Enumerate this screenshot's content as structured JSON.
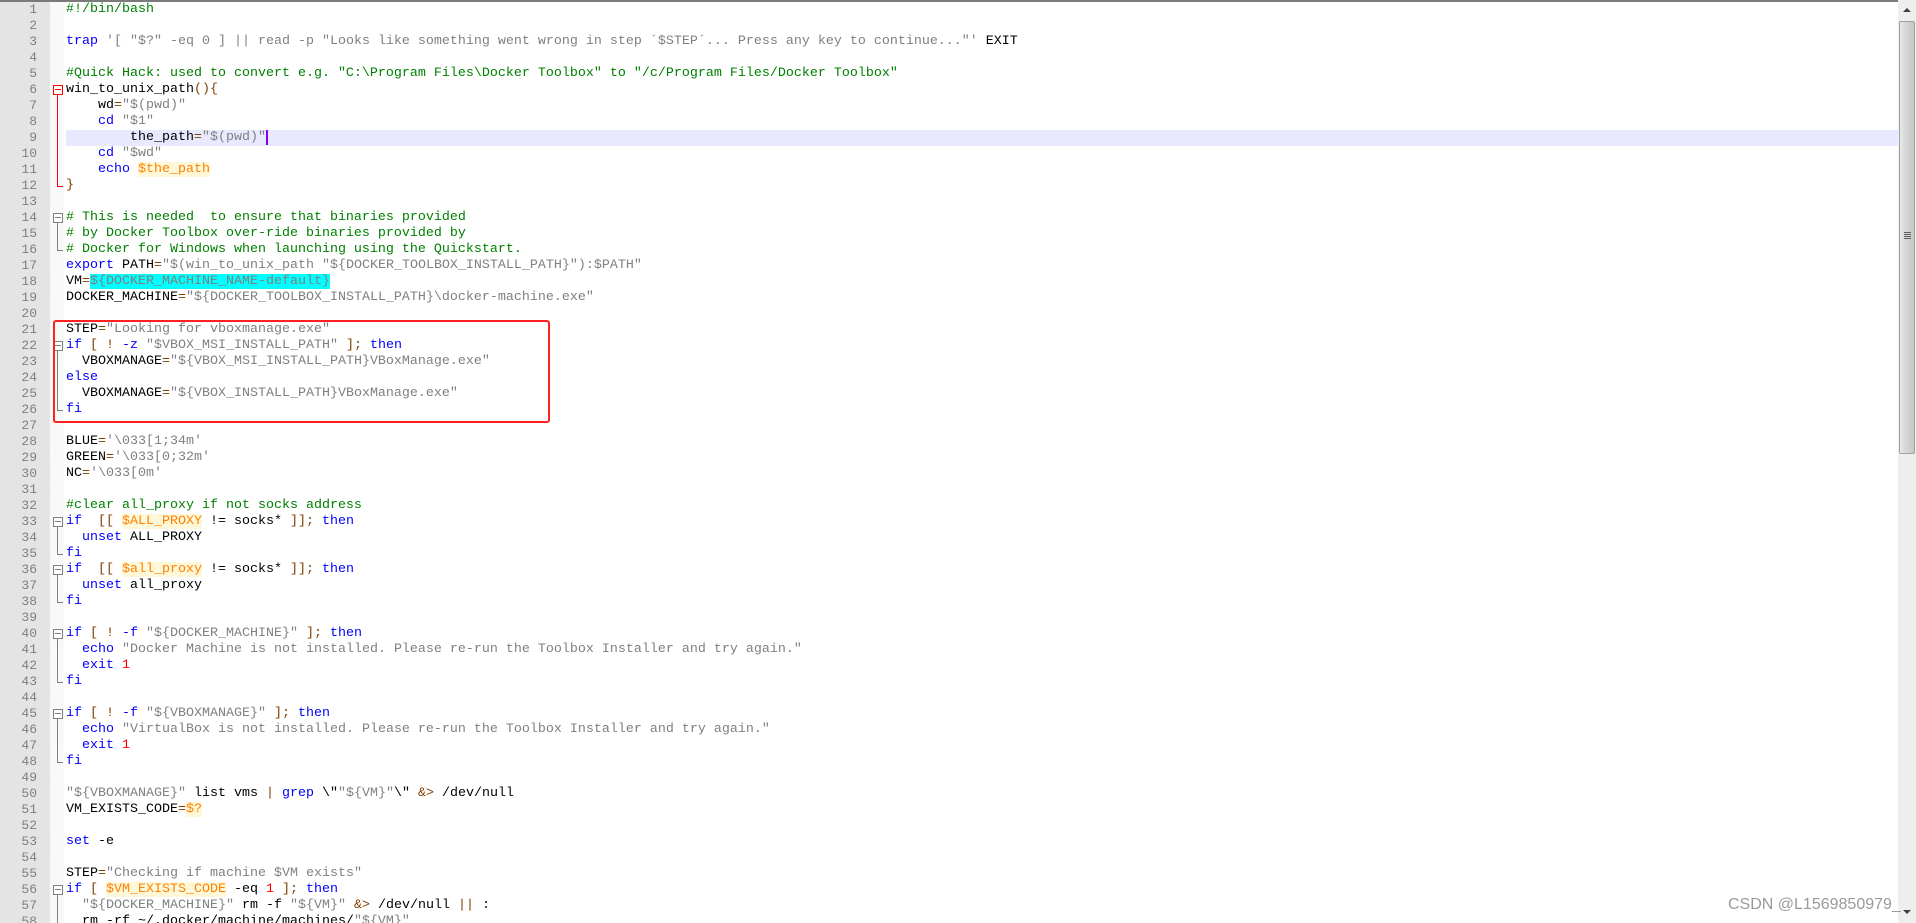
{
  "editor": {
    "current_line": 9,
    "highlighted_block": {
      "from_line": 21,
      "to_line": 26,
      "color": "#ff2020"
    },
    "lines": [
      {
        "n": "1",
        "tokens": [
          {
            "t": "#!/bin/bash",
            "c": "c"
          }
        ]
      },
      {
        "n": "2",
        "tokens": []
      },
      {
        "n": "3",
        "tokens": [
          {
            "t": "trap",
            "c": "k"
          },
          {
            "t": " ",
            "c": "d"
          },
          {
            "t": "'[ \"$?\" -eq 0 ] || read -p \"Looks like something went wrong in step ´$STEP´... Press any key to continue...\"'",
            "c": "s"
          },
          {
            "t": " EXIT",
            "c": "d"
          }
        ]
      },
      {
        "n": "4",
        "tokens": []
      },
      {
        "n": "5",
        "tokens": [
          {
            "t": "#Quick Hack: used to convert e.g. \"C:\\Program Files\\Docker Toolbox\" to \"/c/Program Files/Docker Toolbox\"",
            "c": "c"
          }
        ]
      },
      {
        "n": "6",
        "fold": "open",
        "active": true,
        "tokens": [
          {
            "t": "win_to_unix_path",
            "c": "d"
          },
          {
            "t": "(){",
            "c": "o"
          }
        ]
      },
      {
        "n": "7",
        "fold": "body",
        "active": true,
        "tokens": [
          {
            "t": "    wd",
            "c": "d"
          },
          {
            "t": "=",
            "c": "o"
          },
          {
            "t": "\"$(pwd)\"",
            "c": "s"
          }
        ]
      },
      {
        "n": "8",
        "fold": "body",
        "active": true,
        "tokens": [
          {
            "t": "    ",
            "c": "d"
          },
          {
            "t": "cd",
            "c": "k"
          },
          {
            "t": " ",
            "c": "d"
          },
          {
            "t": "\"$1\"",
            "c": "s"
          }
        ]
      },
      {
        "n": "9",
        "fold": "body",
        "active": true,
        "tokens": [
          {
            "t": "        the_path",
            "c": "d"
          },
          {
            "t": "=",
            "c": "o"
          },
          {
            "t": "\"$(pwd)\"",
            "c": "s"
          }
        ]
      },
      {
        "n": "10",
        "fold": "body",
        "active": true,
        "tokens": [
          {
            "t": "    ",
            "c": "d"
          },
          {
            "t": "cd",
            "c": "k"
          },
          {
            "t": " ",
            "c": "d"
          },
          {
            "t": "\"$wd\"",
            "c": "s"
          }
        ]
      },
      {
        "n": "11",
        "fold": "body",
        "active": true,
        "tokens": [
          {
            "t": "    ",
            "c": "d"
          },
          {
            "t": "echo",
            "c": "k"
          },
          {
            "t": " ",
            "c": "d"
          },
          {
            "t": "$the_path",
            "c": "v"
          }
        ]
      },
      {
        "n": "12",
        "fold": "end",
        "active": true,
        "tokens": [
          {
            "t": "}",
            "c": "o"
          }
        ]
      },
      {
        "n": "13",
        "tokens": []
      },
      {
        "n": "14",
        "fold": "open",
        "tokens": [
          {
            "t": "# This is needed  to ensure that binaries provided",
            "c": "c"
          }
        ]
      },
      {
        "n": "15",
        "fold": "body",
        "tokens": [
          {
            "t": "# by Docker Toolbox over-ride binaries provided by",
            "c": "c"
          }
        ]
      },
      {
        "n": "16",
        "fold": "end",
        "tokens": [
          {
            "t": "# Docker for Windows when launching using the Quickstart.",
            "c": "c"
          }
        ]
      },
      {
        "n": "17",
        "tokens": [
          {
            "t": "export",
            "c": "k"
          },
          {
            "t": " PATH",
            "c": "d"
          },
          {
            "t": "=",
            "c": "o"
          },
          {
            "t": "\"$(win_to_unix_path \"${DOCKER_TOOLBOX_INSTALL_PATH}\"):$PATH\"",
            "c": "s"
          }
        ]
      },
      {
        "n": "18",
        "tokens": [
          {
            "t": "VM",
            "c": "d"
          },
          {
            "t": "=",
            "c": "o"
          },
          {
            "t": "${DOCKER_MACHINE_NAME-default}",
            "c": "h"
          }
        ]
      },
      {
        "n": "19",
        "tokens": [
          {
            "t": "DOCKER_MACHINE",
            "c": "d"
          },
          {
            "t": "=",
            "c": "o"
          },
          {
            "t": "\"${DOCKER_TOOLBOX_INSTALL_PATH}\\docker-machine.exe\"",
            "c": "s"
          }
        ]
      },
      {
        "n": "20",
        "tokens": []
      },
      {
        "n": "21",
        "tokens": [
          {
            "t": "STEP",
            "c": "d"
          },
          {
            "t": "=",
            "c": "o"
          },
          {
            "t": "\"Looking for vboxmanage.exe\"",
            "c": "s"
          }
        ]
      },
      {
        "n": "22",
        "fold": "open",
        "tokens": [
          {
            "t": "if",
            "c": "k"
          },
          {
            "t": " [ ! ",
            "c": "o"
          },
          {
            "t": "-z",
            "c": "k"
          },
          {
            "t": " ",
            "c": "d"
          },
          {
            "t": "\"$VBOX_MSI_INSTALL_PATH\"",
            "c": "s"
          },
          {
            "t": " ];",
            "c": "o"
          },
          {
            "t": " ",
            "c": "d"
          },
          {
            "t": "then",
            "c": "k"
          }
        ]
      },
      {
        "n": "23",
        "fold": "body",
        "tokens": [
          {
            "t": "  VBOXMANAGE",
            "c": "d"
          },
          {
            "t": "=",
            "c": "o"
          },
          {
            "t": "\"${VBOX_MSI_INSTALL_PATH}VBoxManage.exe\"",
            "c": "s"
          }
        ]
      },
      {
        "n": "24",
        "fold": "body",
        "tokens": [
          {
            "t": "else",
            "c": "k"
          }
        ]
      },
      {
        "n": "25",
        "fold": "body",
        "tokens": [
          {
            "t": "  VBOXMANAGE",
            "c": "d"
          },
          {
            "t": "=",
            "c": "o"
          },
          {
            "t": "\"${VBOX_INSTALL_PATH}VBoxManage.exe\"",
            "c": "s"
          }
        ]
      },
      {
        "n": "26",
        "fold": "end",
        "tokens": [
          {
            "t": "fi",
            "c": "k"
          }
        ]
      },
      {
        "n": "27",
        "tokens": []
      },
      {
        "n": "28",
        "tokens": [
          {
            "t": "BLUE",
            "c": "d"
          },
          {
            "t": "=",
            "c": "o"
          },
          {
            "t": "'\\033[1;34m'",
            "c": "s"
          }
        ]
      },
      {
        "n": "29",
        "tokens": [
          {
            "t": "GREEN",
            "c": "d"
          },
          {
            "t": "=",
            "c": "o"
          },
          {
            "t": "'\\033[0;32m'",
            "c": "s"
          }
        ]
      },
      {
        "n": "30",
        "tokens": [
          {
            "t": "NC",
            "c": "d"
          },
          {
            "t": "=",
            "c": "o"
          },
          {
            "t": "'\\033[0m'",
            "c": "s"
          }
        ]
      },
      {
        "n": "31",
        "tokens": []
      },
      {
        "n": "32",
        "tokens": [
          {
            "t": "#clear all_proxy if not socks address",
            "c": "c"
          }
        ]
      },
      {
        "n": "33",
        "fold": "open",
        "tokens": [
          {
            "t": "if",
            "c": "k"
          },
          {
            "t": "  [[ ",
            "c": "o"
          },
          {
            "t": "$ALL_PROXY",
            "c": "v"
          },
          {
            "t": " != socks* ",
            "c": "d"
          },
          {
            "t": "]];",
            "c": "o"
          },
          {
            "t": " ",
            "c": "d"
          },
          {
            "t": "then",
            "c": "k"
          }
        ]
      },
      {
        "n": "34",
        "fold": "body",
        "tokens": [
          {
            "t": "  ",
            "c": "d"
          },
          {
            "t": "unset",
            "c": "k"
          },
          {
            "t": " ALL_PROXY",
            "c": "d"
          }
        ]
      },
      {
        "n": "35",
        "fold": "end",
        "tokens": [
          {
            "t": "fi",
            "c": "k"
          }
        ]
      },
      {
        "n": "36",
        "fold": "open",
        "tokens": [
          {
            "t": "if",
            "c": "k"
          },
          {
            "t": "  [[ ",
            "c": "o"
          },
          {
            "t": "$all_proxy",
            "c": "v"
          },
          {
            "t": " != socks* ",
            "c": "d"
          },
          {
            "t": "]];",
            "c": "o"
          },
          {
            "t": " ",
            "c": "d"
          },
          {
            "t": "then",
            "c": "k"
          }
        ]
      },
      {
        "n": "37",
        "fold": "body",
        "tokens": [
          {
            "t": "  ",
            "c": "d"
          },
          {
            "t": "unset",
            "c": "k"
          },
          {
            "t": " all_proxy",
            "c": "d"
          }
        ]
      },
      {
        "n": "38",
        "fold": "end",
        "tokens": [
          {
            "t": "fi",
            "c": "k"
          }
        ]
      },
      {
        "n": "39",
        "tokens": []
      },
      {
        "n": "40",
        "fold": "open",
        "tokens": [
          {
            "t": "if",
            "c": "k"
          },
          {
            "t": " [ ! ",
            "c": "o"
          },
          {
            "t": "-f",
            "c": "k"
          },
          {
            "t": " ",
            "c": "d"
          },
          {
            "t": "\"${DOCKER_MACHINE}\"",
            "c": "s"
          },
          {
            "t": " ];",
            "c": "o"
          },
          {
            "t": " ",
            "c": "d"
          },
          {
            "t": "then",
            "c": "k"
          }
        ]
      },
      {
        "n": "41",
        "fold": "body",
        "tokens": [
          {
            "t": "  ",
            "c": "d"
          },
          {
            "t": "echo",
            "c": "k"
          },
          {
            "t": " ",
            "c": "d"
          },
          {
            "t": "\"Docker Machine is not installed. Please re-run the Toolbox Installer and try again.\"",
            "c": "s"
          }
        ]
      },
      {
        "n": "42",
        "fold": "body",
        "tokens": [
          {
            "t": "  ",
            "c": "d"
          },
          {
            "t": "exit",
            "c": "k"
          },
          {
            "t": " ",
            "c": "d"
          },
          {
            "t": "1",
            "c": "n"
          }
        ]
      },
      {
        "n": "43",
        "fold": "end",
        "tokens": [
          {
            "t": "fi",
            "c": "k"
          }
        ]
      },
      {
        "n": "44",
        "tokens": []
      },
      {
        "n": "45",
        "fold": "open",
        "tokens": [
          {
            "t": "if",
            "c": "k"
          },
          {
            "t": " [ ! ",
            "c": "o"
          },
          {
            "t": "-f",
            "c": "k"
          },
          {
            "t": " ",
            "c": "d"
          },
          {
            "t": "\"${VBOXMANAGE}\"",
            "c": "s"
          },
          {
            "t": " ];",
            "c": "o"
          },
          {
            "t": " ",
            "c": "d"
          },
          {
            "t": "then",
            "c": "k"
          }
        ]
      },
      {
        "n": "46",
        "fold": "body",
        "tokens": [
          {
            "t": "  ",
            "c": "d"
          },
          {
            "t": "echo",
            "c": "k"
          },
          {
            "t": " ",
            "c": "d"
          },
          {
            "t": "\"VirtualBox is not installed. Please re-run the Toolbox Installer and try again.\"",
            "c": "s"
          }
        ]
      },
      {
        "n": "47",
        "fold": "body",
        "tokens": [
          {
            "t": "  ",
            "c": "d"
          },
          {
            "t": "exit",
            "c": "k"
          },
          {
            "t": " ",
            "c": "d"
          },
          {
            "t": "1",
            "c": "n"
          }
        ]
      },
      {
        "n": "48",
        "fold": "end",
        "tokens": [
          {
            "t": "fi",
            "c": "k"
          }
        ]
      },
      {
        "n": "49",
        "tokens": []
      },
      {
        "n": "50",
        "tokens": [
          {
            "t": "\"${VBOXMANAGE}\"",
            "c": "s"
          },
          {
            "t": " list vms ",
            "c": "d"
          },
          {
            "t": "|",
            "c": "o"
          },
          {
            "t": " ",
            "c": "d"
          },
          {
            "t": "grep",
            "c": "k"
          },
          {
            "t": " \\\"",
            "c": "d"
          },
          {
            "t": "\"${VM}\"",
            "c": "s"
          },
          {
            "t": "\\\" ",
            "c": "d"
          },
          {
            "t": "&>",
            "c": "o"
          },
          {
            "t": " /dev/null",
            "c": "d"
          }
        ]
      },
      {
        "n": "51",
        "tokens": [
          {
            "t": "VM_EXISTS_CODE",
            "c": "d"
          },
          {
            "t": "=",
            "c": "o"
          },
          {
            "t": "$?",
            "c": "v"
          }
        ]
      },
      {
        "n": "52",
        "tokens": []
      },
      {
        "n": "53",
        "tokens": [
          {
            "t": "set",
            "c": "k"
          },
          {
            "t": " -e",
            "c": "d"
          }
        ]
      },
      {
        "n": "54",
        "tokens": []
      },
      {
        "n": "55",
        "tokens": [
          {
            "t": "STEP",
            "c": "d"
          },
          {
            "t": "=",
            "c": "o"
          },
          {
            "t": "\"Checking if machine $VM exists\"",
            "c": "s"
          }
        ]
      },
      {
        "n": "56",
        "fold": "open",
        "tokens": [
          {
            "t": "if",
            "c": "k"
          },
          {
            "t": " [ ",
            "c": "o"
          },
          {
            "t": "$VM_EXISTS_CODE",
            "c": "v"
          },
          {
            "t": " -eq ",
            "c": "d"
          },
          {
            "t": "1",
            "c": "n"
          },
          {
            "t": " ];",
            "c": "o"
          },
          {
            "t": " ",
            "c": "d"
          },
          {
            "t": "then",
            "c": "k"
          }
        ]
      },
      {
        "n": "57",
        "fold": "body",
        "tokens": [
          {
            "t": "  ",
            "c": "d"
          },
          {
            "t": "\"${DOCKER_MACHINE}\"",
            "c": "s"
          },
          {
            "t": " rm -f ",
            "c": "d"
          },
          {
            "t": "\"${VM}\"",
            "c": "s"
          },
          {
            "t": " ",
            "c": "d"
          },
          {
            "t": "&>",
            "c": "o"
          },
          {
            "t": " /dev/null ",
            "c": "d"
          },
          {
            "t": "||",
            "c": "o"
          },
          {
            "t": " :",
            "c": "d"
          }
        ]
      },
      {
        "n": "58",
        "fold": "body",
        "tokens": [
          {
            "t": "  rm -rf ~/.docker/machine/machines/",
            "c": "d"
          },
          {
            "t": "\"${VM}\"",
            "c": "s"
          }
        ]
      }
    ]
  },
  "watermark": "CSDN @L1569850979_",
  "colors": {
    "keyword": "#0000ff",
    "string": "#808080",
    "comment": "#008000",
    "operator": "#804000",
    "number": "#ff0000",
    "variable": "#ff8000",
    "current_line_bg": "#e8e8ff",
    "selection_highlight": "#00ffff",
    "annotation_box": "#ff2020"
  }
}
